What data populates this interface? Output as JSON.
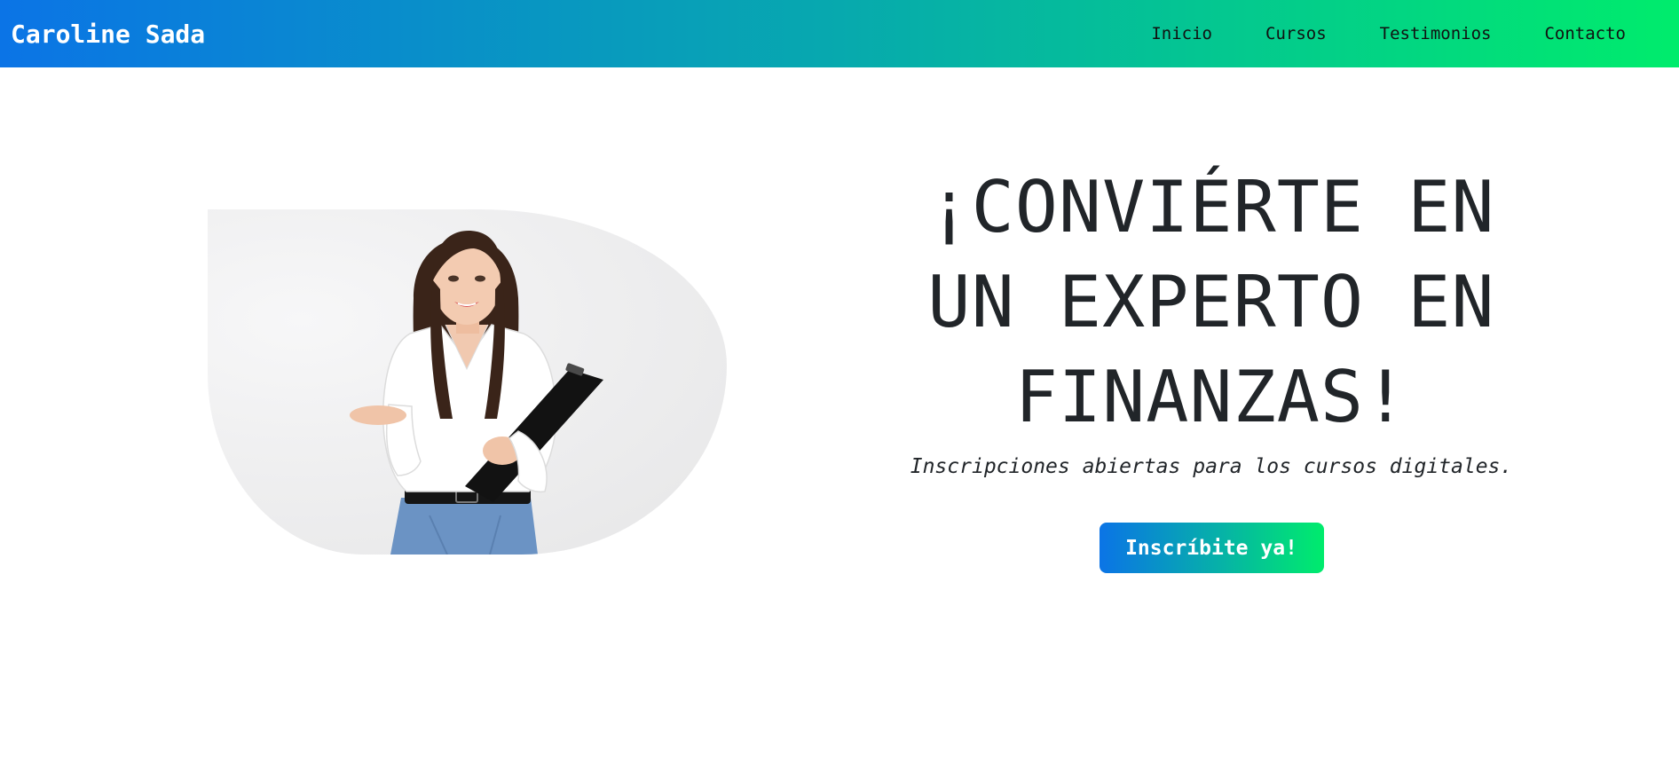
{
  "header": {
    "brand": "Caroline Sada",
    "nav": [
      {
        "label": "Inicio"
      },
      {
        "label": "Cursos"
      },
      {
        "label": "Testimonios"
      },
      {
        "label": "Contacto"
      }
    ],
    "gradient_start": "#0b74e6",
    "gradient_end": "#00ec6c"
  },
  "hero": {
    "title": "¡CONVIÉRTE EN UN EXPERTO EN FINANZAS!",
    "subtitle": "Inscripciones abiertas para los cursos digitales.",
    "cta_label": "Inscríbite ya!",
    "image": {
      "alt": ""
    }
  }
}
